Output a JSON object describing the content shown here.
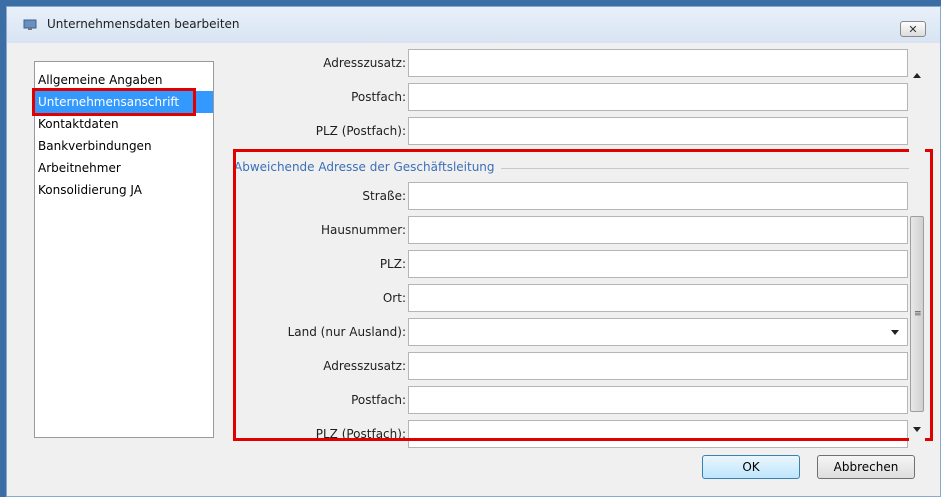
{
  "window": {
    "title": "Unternehmensdaten bearbeiten",
    "close_label": "✕"
  },
  "nav": {
    "items": [
      {
        "label": "Allgemeine Angaben",
        "selected": false
      },
      {
        "label": "Unternehmensanschrift",
        "selected": true
      },
      {
        "label": "Kontaktdaten",
        "selected": false
      },
      {
        "label": "Bankverbindungen",
        "selected": false
      },
      {
        "label": "Arbeitnehmer",
        "selected": false
      },
      {
        "label": "Konsolidierung JA",
        "selected": false
      }
    ]
  },
  "form": {
    "top_fields": [
      {
        "label": "Adresszusatz:",
        "value": ""
      },
      {
        "label": "Postfach:",
        "value": ""
      },
      {
        "label": "PLZ (Postfach):",
        "value": ""
      }
    ],
    "group_title": "Abweichende Adresse der Geschäftsleitung",
    "group_fields": [
      {
        "label": "Straße:",
        "value": ""
      },
      {
        "label": "Hausnummer:",
        "value": ""
      },
      {
        "label": "PLZ:",
        "value": ""
      },
      {
        "label": "Ort:",
        "value": ""
      },
      {
        "label": "Land (nur Ausland):",
        "value": "",
        "type": "dropdown"
      },
      {
        "label": "Adresszusatz:",
        "value": ""
      },
      {
        "label": "Postfach:",
        "value": ""
      },
      {
        "label": "PLZ (Postfach):",
        "value": ""
      }
    ]
  },
  "buttons": {
    "ok": "OK",
    "cancel": "Abbrechen"
  },
  "colors": {
    "selection": "#3399ff",
    "highlight_outline": "#e00000",
    "group_title": "#3b6fb6"
  }
}
